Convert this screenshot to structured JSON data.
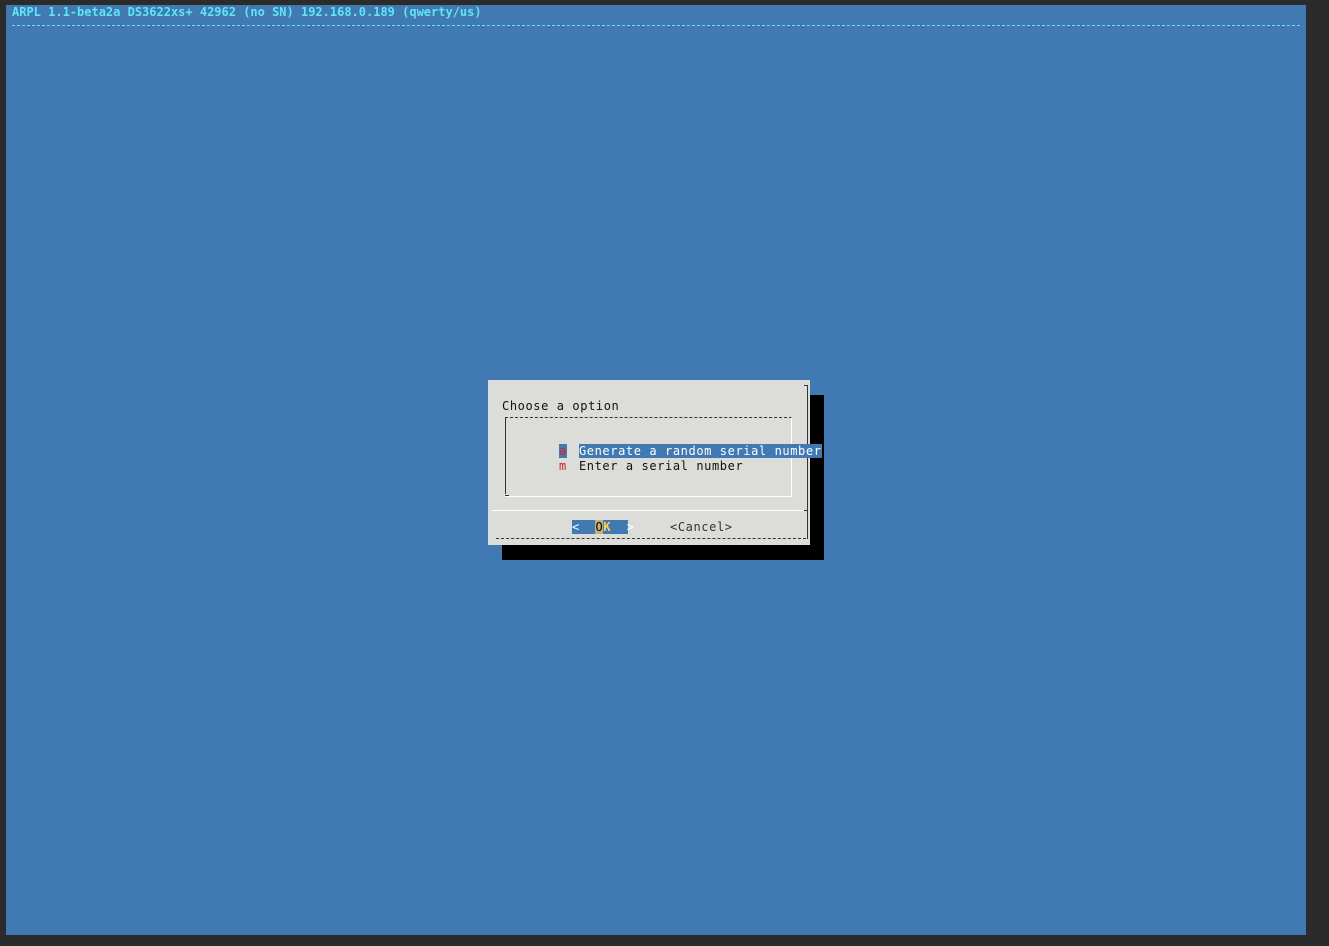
{
  "backtitle": "ARPL 1.1-beta2a DS3622xs+ 42962 (no SN) 192.168.0.189 (qwerty/us)",
  "dialog": {
    "prompt": "Choose a option",
    "items": [
      {
        "tag": "a",
        "label": "Generate a random serial number",
        "selected": true
      },
      {
        "tag": "m",
        "label": "Enter a serial number",
        "selected": false
      }
    ],
    "ok_button": {
      "left": "<  ",
      "cursor": "O",
      "hot": "K",
      "right": "  >"
    },
    "cancel_label": "<Cancel>"
  },
  "colors": {
    "background": "#4179b3",
    "title": "#5fe6f5",
    "dialog": "#dcdcd8",
    "tag": "#d62020",
    "highlight": "#4179b3",
    "hotkey": "#ffd24a"
  }
}
